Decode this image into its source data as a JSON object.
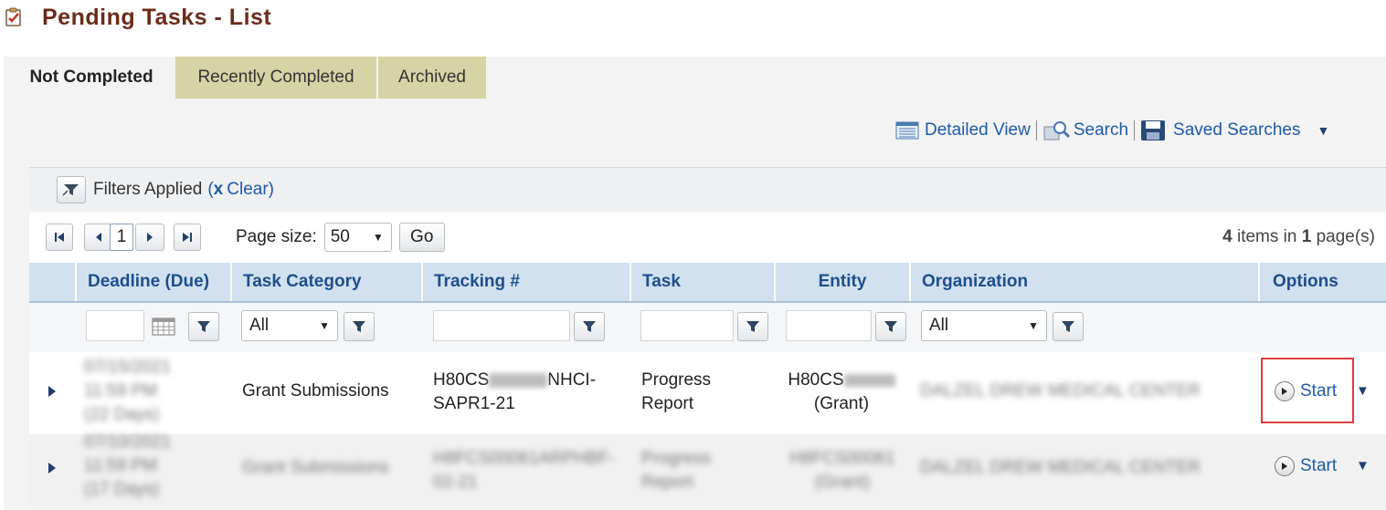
{
  "page": {
    "title": "Pending Tasks - List"
  },
  "tabs": [
    {
      "label": "Not Completed",
      "active": true
    },
    {
      "label": "Recently Completed",
      "active": false
    },
    {
      "label": "Archived",
      "active": false
    }
  ],
  "toolbar": {
    "detailed_view": "Detailed View",
    "search": "Search",
    "saved_searches": "Saved Searches"
  },
  "filters": {
    "applied_label": "Filters Applied",
    "clear_open": "(",
    "clear_x": "x",
    "clear_label": "Clear)"
  },
  "pager": {
    "current_page": "1",
    "page_size_label": "Page size:",
    "page_size_value": "50",
    "go_label": "Go",
    "items_count": "4",
    "items_text": " items in ",
    "pages_count": "1",
    "pages_text": " page(s)"
  },
  "columns": [
    "Deadline (Due)",
    "Task Category",
    "Tracking #",
    "Task",
    "Entity",
    "Organization",
    "Options"
  ],
  "column_filters": {
    "task_category": "All",
    "organization": "All"
  },
  "rows": [
    {
      "deadline": [
        "07/15/2021",
        "11:59 PM",
        "(22 Days)"
      ],
      "task_category": "Grant Submissions",
      "tracking_line1_prefix": "H80CS",
      "tracking_line1_suffix": "NHCI-",
      "tracking_line2": "SAPR1-21",
      "task_line1": "Progress",
      "task_line2": "Report",
      "entity_prefix": "H80CS",
      "entity_line2": "(Grant)",
      "organization": "DALZEL DREW MEDICAL CENTER",
      "option": "Start"
    },
    {
      "deadline": [
        "07/10/2021",
        "11:59 PM",
        "(17 Days)"
      ],
      "task_category": "Grant Submissions",
      "tracking": "H8FCS00061ARPHBF-02-21",
      "task": "Progress Report",
      "entity": "H8FCS00061 (Grant)",
      "organization": "DALZEL DREW MEDICAL CENTER",
      "option": "Start"
    }
  ],
  "colors": {
    "title": "#6b2c1a",
    "link": "#1f5aa8",
    "header_bg": "#d1e1ef",
    "tab_inactive_bg": "#d6d3a5",
    "highlight": "#e03c3c"
  }
}
